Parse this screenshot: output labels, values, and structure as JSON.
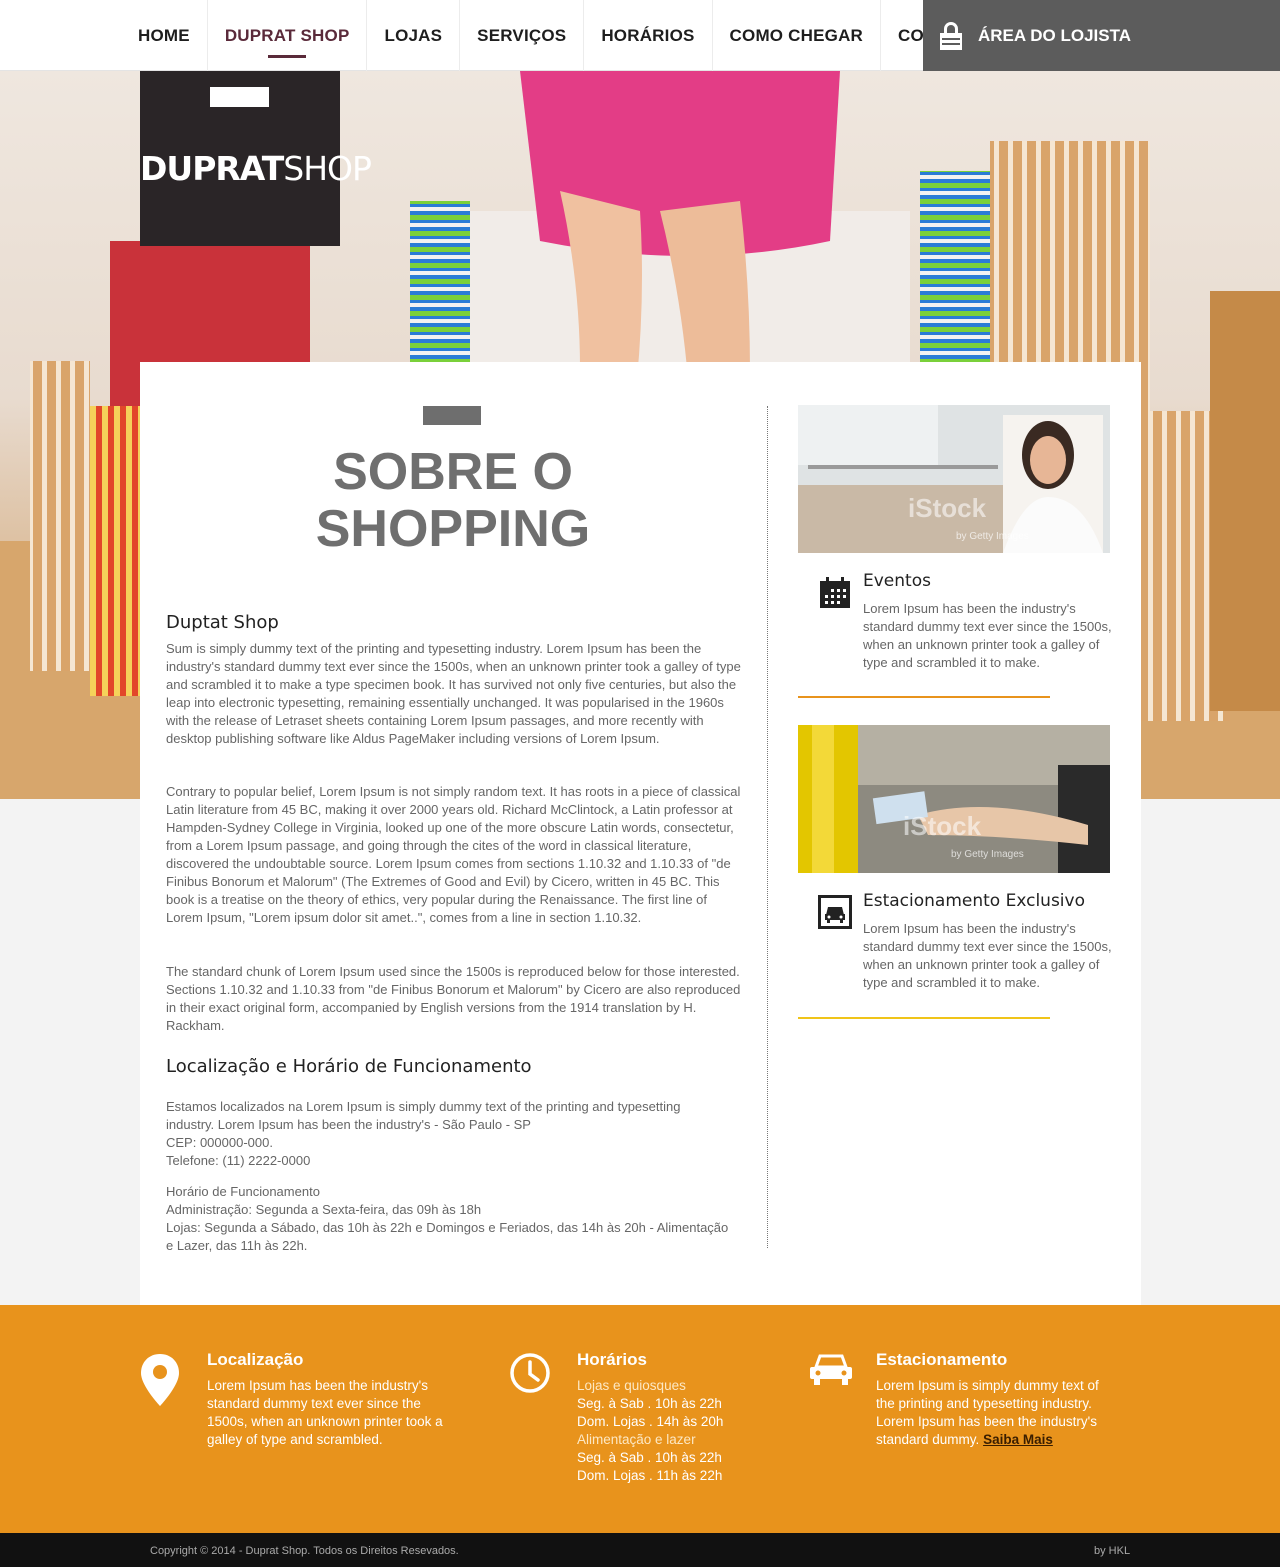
{
  "nav": {
    "items": [
      "HOME",
      "DUPRAT SHOP",
      "LOJAS",
      "SERVIÇOS",
      "HORÁRIOS",
      "COMO CHEGAR",
      "CONTATO"
    ],
    "active": "DUPRAT SHOP",
    "lojista_label": "ÁREA DO LOJISTA"
  },
  "logo": {
    "bold": "DUPRAT",
    "light": "SHOP"
  },
  "main": {
    "title_line1": "SOBRE O",
    "title_line2": "SHOPPING",
    "section1_title": "Duptat Shop",
    "para1": "Sum is simply dummy text of the printing and typesetting industry. Lorem Ipsum has been the industry's standard dummy text ever since the 1500s, when an unknown printer took a galley of type and scrambled it to make a type specimen book. It has survived not only five centuries, but also the leap into electronic typesetting, remaining essentially unchanged. It was popularised in the 1960s with the release of Letraset sheets containing Lorem Ipsum passages, and more recently with desktop publishing software like Aldus PageMaker including versions of Lorem Ipsum.",
    "para2": "Contrary to popular belief, Lorem Ipsum is not simply random text. It has roots in a piece of classical Latin literature from 45 BC, making it over 2000 years old. Richard McClintock, a Latin professor at Hampden-Sydney College in Virginia, looked up one of the more obscure Latin words, consectetur, from a Lorem Ipsum passage, and going through the cites of the word in classical literature, discovered the undoubtable source. Lorem Ipsum comes from sections 1.10.32 and 1.10.33 of \"de Finibus Bonorum et Malorum\" (The Extremes of Good and Evil) by Cicero, written in 45 BC. This book is a treatise on the theory of ethics, very popular during the Renaissance. The first line of Lorem Ipsum, \"Lorem ipsum dolor sit amet..\", comes from a line in section 1.10.32.",
    "para3": "The standard chunk of Lorem Ipsum used since the 1500s is reproduced below for those interested. Sections 1.10.32 and 1.10.33 from \"de Finibus Bonorum et Malorum\" by Cicero are also reproduced in their exact original form, accompanied by English versions from the 1914 translation by H. Rackham.",
    "section2_title": "Localização e Horário de Funcionamento",
    "address_lines": [
      "Estamos localizados na Lorem Ipsum is simply dummy text of the printing and typesetting",
      "industry. Lorem Ipsum has been the industry's - São Paulo - SP",
      "CEP: 000000-000.",
      "Telefone: (11) 2222-0000"
    ],
    "hours_lines": [
      "Horário de Funcionamento",
      "Administração: Segunda a Sexta-feira, das 09h às 18h",
      "Lojas: Segunda a Sábado, das 10h às 22h e Domingos e Feriados, das 14h às 20h - Alimentação",
      "e Lazer, das 11h às 22h."
    ]
  },
  "sidebar": {
    "eventos_title": "Eventos",
    "eventos_text": "Lorem Ipsum has been the industry's standard dummy text ever since the 1500s, when an unknown printer took a galley of type and scrambled it to make.",
    "estac_title": "Estacionamento Exclusivo",
    "estac_text": "Lorem Ipsum has been the industry's standard dummy text ever since the 1500s, when an unknown printer took a galley of type and scrambled it to make.",
    "watermark": "iStock",
    "watermark_sub": "by Getty Images"
  },
  "footer": {
    "loc_title": "Localização",
    "loc_lines": [
      "Lorem Ipsum has been the industry's",
      "standard dummy text ever since the",
      "1500s, when an unknown printer took a",
      "galley of type and scrambled."
    ],
    "hor_title": "Horários",
    "hor_lines": [
      "Lojas e quiosques",
      "Seg. à Sab . 10h às 22h",
      "Dom. Lojas . 14h às 20h",
      "Alimentação e lazer",
      "Seg. à Sab . 10h às 22h",
      "Dom. Lojas . 11h às 22h"
    ],
    "est_title": "Estacionamento",
    "est_lines": [
      "Lorem Ipsum is simply dummy text of",
      "the printing and typesetting industry.",
      "Lorem Ipsum has been the industry's",
      "standard dummy."
    ],
    "saiba_mais": "Saiba Mais",
    "copyright": "Copyright © 2014 - Duprat Shop. Todos os Direitos Resevados.",
    "credit": "by HKL"
  },
  "colors": {
    "accent_orange": "#e8931c",
    "accent_yellow": "#f0c419",
    "brand_dark": "#2a2527",
    "nav_active": "#5a2a3a"
  }
}
